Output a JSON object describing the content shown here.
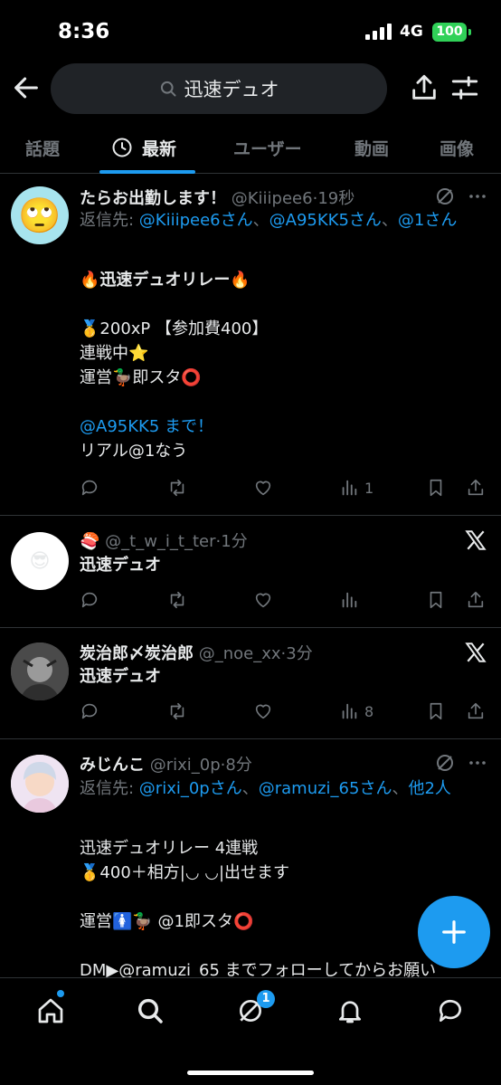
{
  "status_bar": {
    "time": "8:36",
    "network": "4G",
    "battery": "100"
  },
  "header": {
    "search_query": "迅速デュオ"
  },
  "tabs": [
    {
      "label": "話題"
    },
    {
      "label": "最新"
    },
    {
      "label": "ユーザー"
    },
    {
      "label": "動画"
    },
    {
      "label": "画像"
    }
  ],
  "tweets": [
    {
      "name": "たらお出勤します！",
      "handle": "@Kiiipee6",
      "time": "19秒",
      "reply_prefix": "返信先: ",
      "reply_links": [
        "@Kiiipee6さん",
        "@A95KK5さん",
        "@1さん"
      ],
      "reply_sep": "、",
      "lines": [
        "🔥迅速デュオリレー🔥",
        "",
        "🥇200xP 【参加費400】",
        "連戦中⭐",
        "運営🦆即スタ⭕",
        "",
        "@A95KK5 まで！",
        "リアル@1なう"
      ],
      "views": "1"
    },
    {
      "name": "🍣",
      "handle": "@_t_w_i_t_ter",
      "time": "1分",
      "text": "迅速デュオ",
      "views": ""
    },
    {
      "name": "炭治郎〆炭治郎",
      "handle": "@_noe_xx",
      "time": "3分",
      "text": "迅速デュオ",
      "views": "8"
    },
    {
      "name": "みじんこ",
      "handle": "@rixi_0p",
      "time": "8分",
      "reply_prefix": "返信先: ",
      "reply_links": [
        "@rixi_0pさん",
        "@ramuzi_65さん",
        "他2人"
      ],
      "reply_sep": "、",
      "lines": [
        "迅速デュオリレー 4連戦",
        "🥇400＋相方|◡ ◡|出せます",
        "",
        "運営🚺🦆 @1即スタ⭕",
        "",
        "DM▶@ramuzi_65 までフォローしてからお願い"
      ]
    }
  ],
  "nav": {
    "notification_count": "1"
  },
  "colors": {
    "accent": "#1d9bf0",
    "background": "#000000",
    "muted": "#71767b"
  }
}
